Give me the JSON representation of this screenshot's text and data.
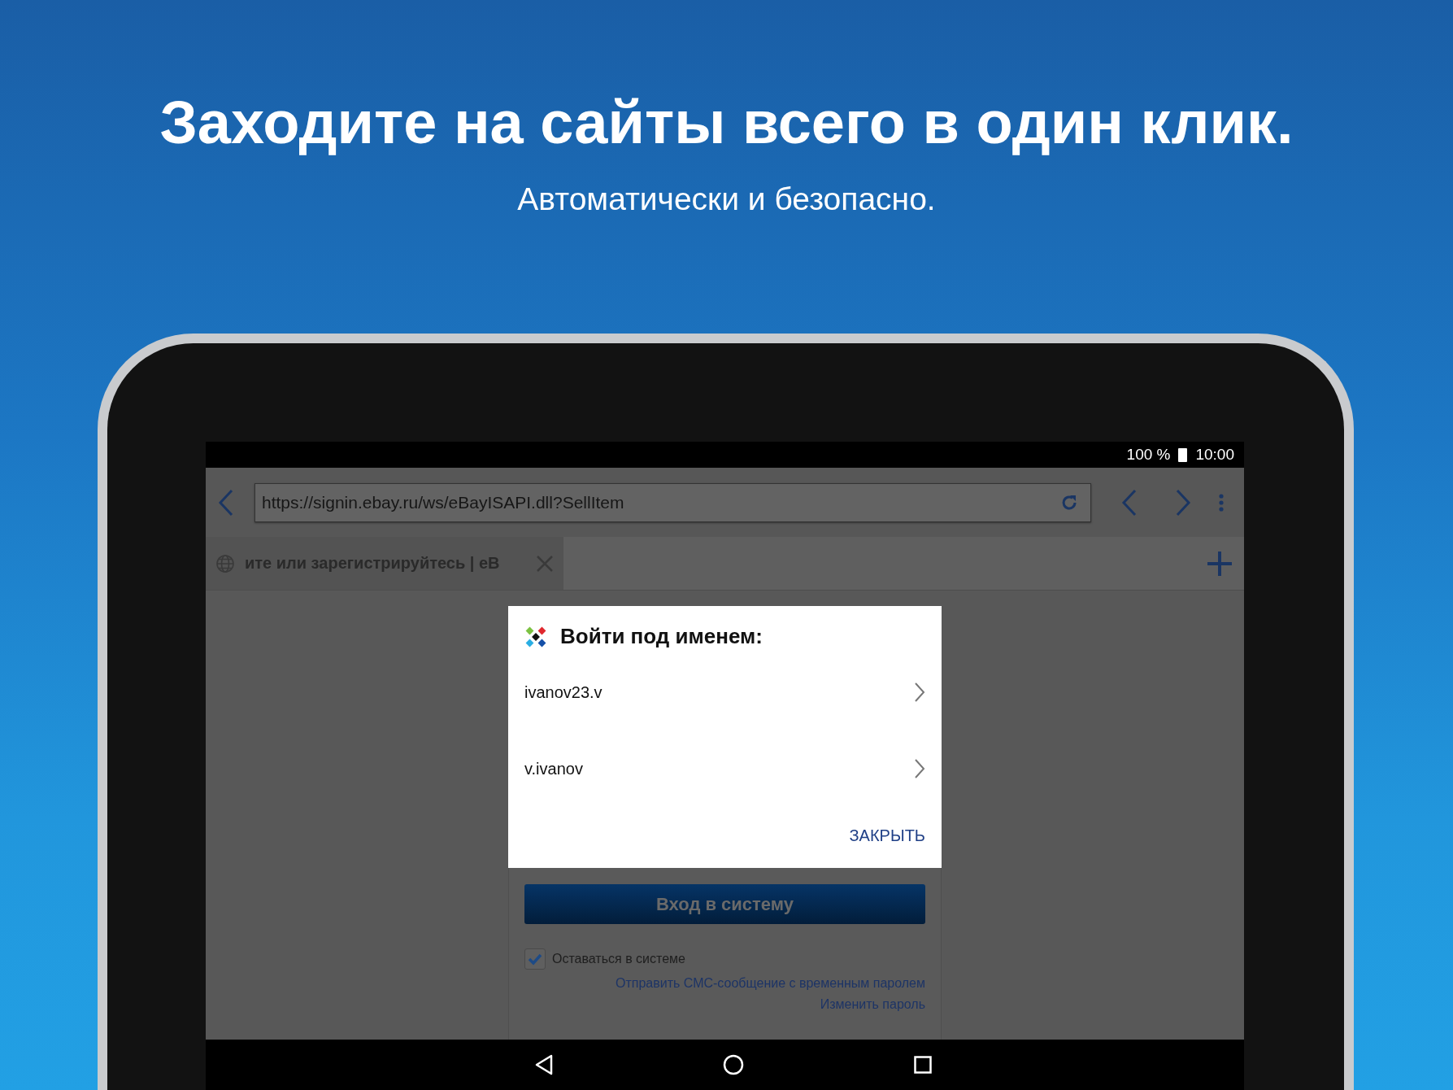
{
  "headline": "Заходите на сайты всего в один клик.",
  "subheadline": "Автоматически и безопасно.",
  "status_bar": {
    "battery": "100 %",
    "time": "10:00"
  },
  "browser": {
    "url": "https://signin.ebay.ru/ws/eBayISAPI.dll?SellItem",
    "tabs": [
      {
        "title": "ите или зарегистрируйтесь | eB",
        "selected": true
      }
    ]
  },
  "dialog": {
    "title": "Войти под именем:",
    "accounts": [
      "ivanov23.v",
      "v.ivanov"
    ],
    "close_button": "ЗАКРЫТЬ"
  },
  "page": {
    "signin_button": "Вход в систему",
    "stay_signed_in": {
      "label": "Оставаться в системе",
      "checked": true
    },
    "links": [
      "Отправить СМС-сообщение с временным паролем",
      "Изменить пароль"
    ]
  }
}
